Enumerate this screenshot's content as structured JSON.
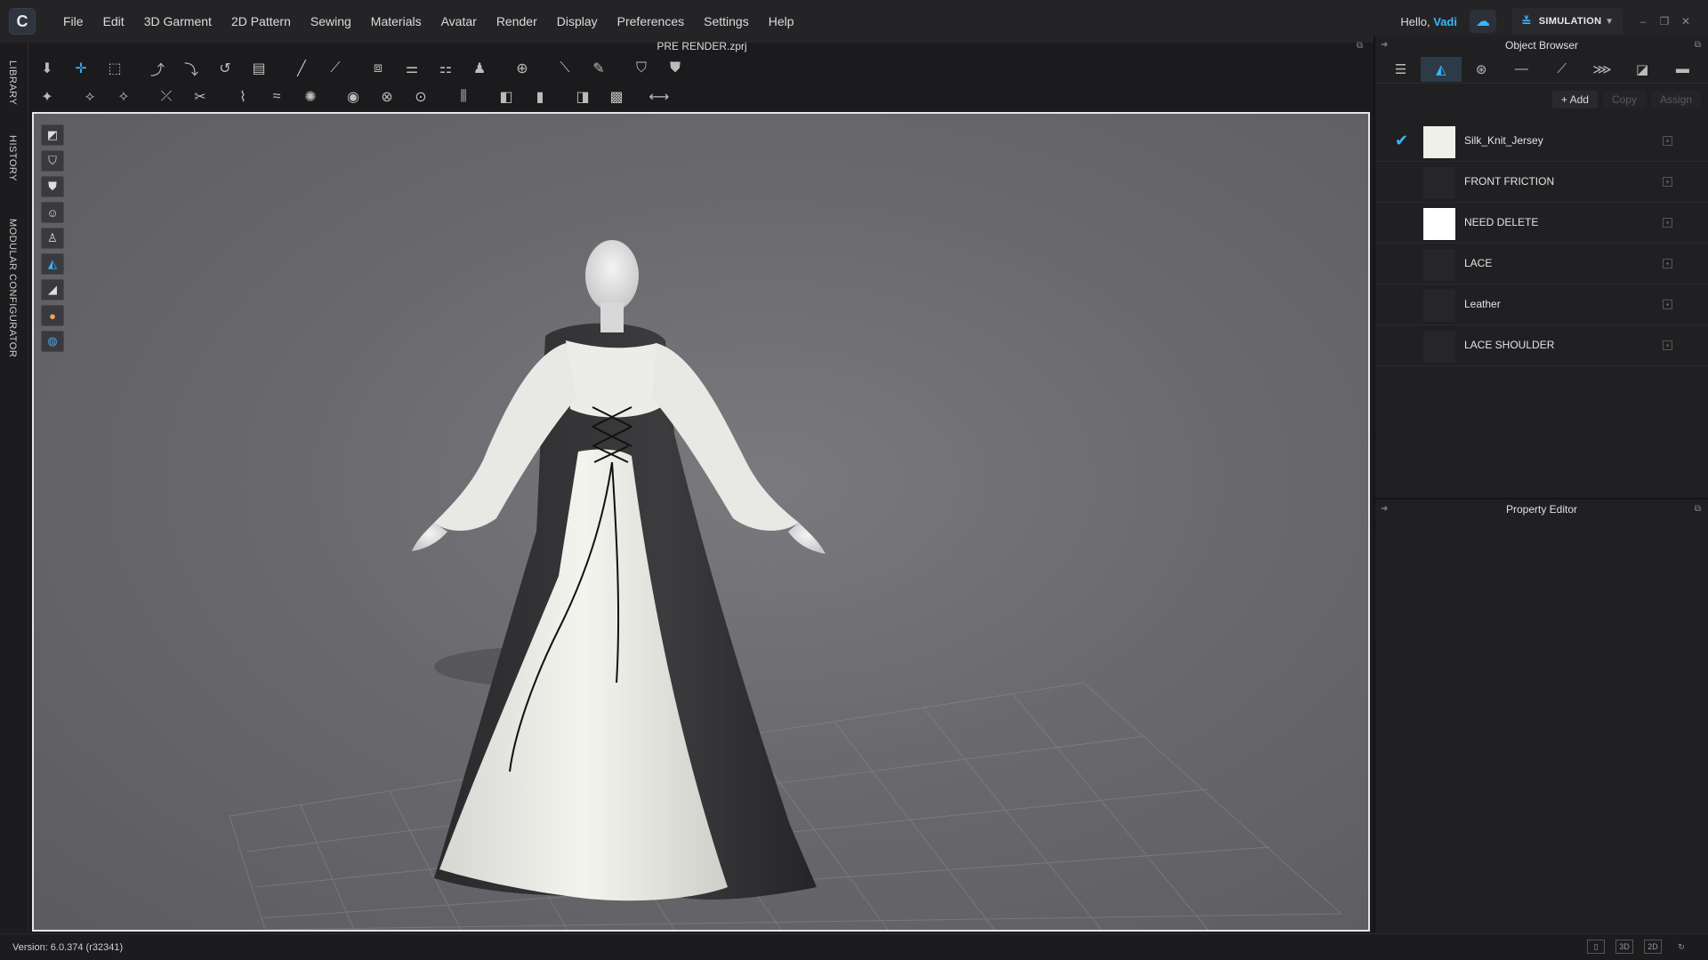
{
  "menubar": {
    "logo_icon": "clo-logo",
    "items": [
      "File",
      "Edit",
      "3D Garment",
      "2D Pattern",
      "Sewing",
      "Materials",
      "Avatar",
      "Render",
      "Display",
      "Preferences",
      "Settings",
      "Help"
    ],
    "greeting_prefix": "Hello, ",
    "user_name": "Vadi",
    "mode_label": "SIMULATION",
    "accent_color": "#38b7ff"
  },
  "left_tabs": [
    "LIBRARY",
    "HISTORY",
    "MODULAR CONFIGURATOR"
  ],
  "view3d": {
    "file_title": "PRE RENDER.zprj"
  },
  "object_browser": {
    "title": "Object Browser",
    "tabs": [
      "list-icon",
      "fabric-icon",
      "button-icon",
      "topstitch-icon",
      "line-icon",
      "zipper-icon",
      "puckering-icon",
      "measure-icon"
    ],
    "actions": {
      "add": "+ Add",
      "copy": "Copy",
      "assign": "Assign"
    },
    "fabrics": [
      {
        "name": "Silk_Knit_Jersey",
        "selected": true,
        "swatch": "#f0f0ea"
      },
      {
        "name": "FRONT FRICTION",
        "selected": false,
        "swatch": "#262629"
      },
      {
        "name": "NEED DELETE",
        "selected": false,
        "swatch": "#ffffff"
      },
      {
        "name": "LACE",
        "selected": false,
        "swatch": "#262629"
      },
      {
        "name": "Leather",
        "selected": false,
        "swatch": "#262629"
      },
      {
        "name": "LACE SHOULDER",
        "selected": false,
        "swatch": "#262629"
      }
    ]
  },
  "property_editor": {
    "title": "Property Editor"
  },
  "statusbar": {
    "version": "Version: 6.0.374 (r32341)"
  }
}
